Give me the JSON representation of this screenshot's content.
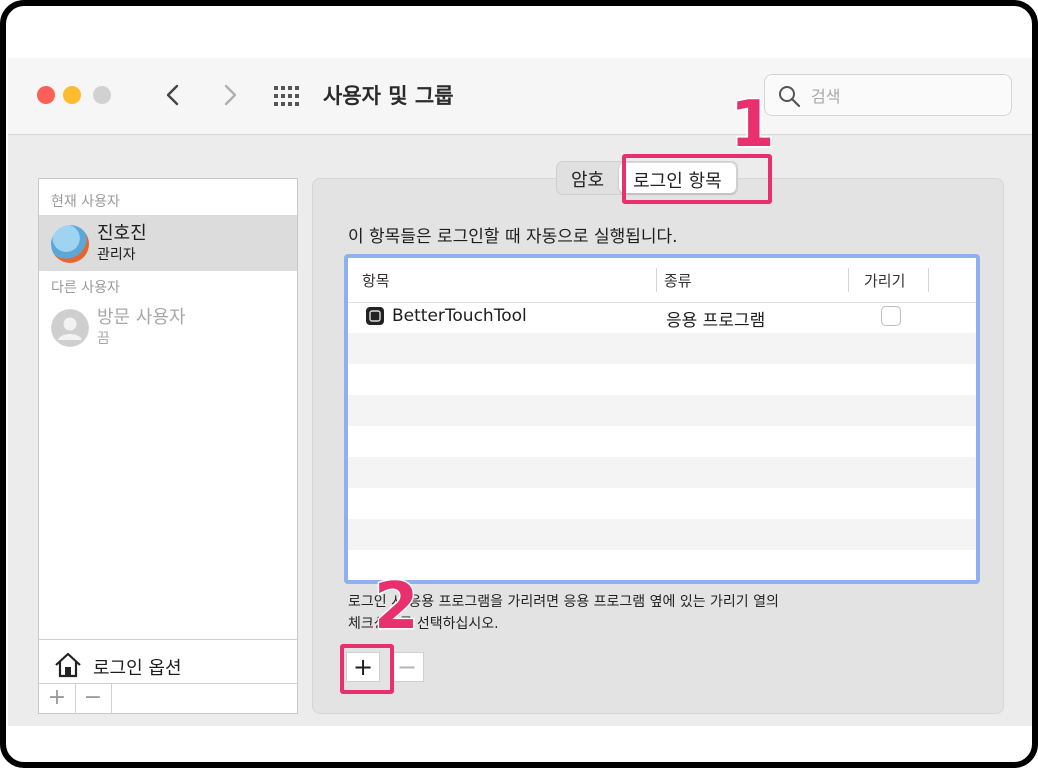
{
  "window": {
    "title": "사용자 및 그룹"
  },
  "search": {
    "placeholder": "검색"
  },
  "sidebar": {
    "current_header": "현재 사용자",
    "current_user": {
      "name": "진호진",
      "role": "관리자"
    },
    "other_header": "다른 사용자",
    "other_user": {
      "name": "방문 사용자",
      "status": "끔"
    },
    "login_options": "로그인 옵션",
    "add_label": "+",
    "remove_label": "−"
  },
  "tabs": [
    {
      "label": "암호",
      "active": false
    },
    {
      "label": "로그인 항목",
      "active": true
    }
  ],
  "main": {
    "description": "이 항목들은 로그인할 때 자동으로 실행됩니다.",
    "columns": [
      "항목",
      "종류",
      "가리기"
    ],
    "rows": [
      {
        "name": "BetterTouchTool",
        "kind": "응용 프로그램",
        "hide": false
      }
    ],
    "note_line1": "로그인 시 응용 프로그램을 가리려면 응용 프로그램 옆에 있는 가리기 열의",
    "note_line2": "체크상자를 선택하십시오.",
    "add_label": "+",
    "remove_label": "−"
  },
  "annotations": [
    {
      "number": "1",
      "target": "로그인 항목 tab"
    },
    {
      "number": "2",
      "target": "+ button"
    }
  ],
  "colors": {
    "highlight": "#e8306e",
    "table_focus": "#8fb0ee",
    "close": "#fe5f57",
    "minimize": "#febc2e"
  }
}
